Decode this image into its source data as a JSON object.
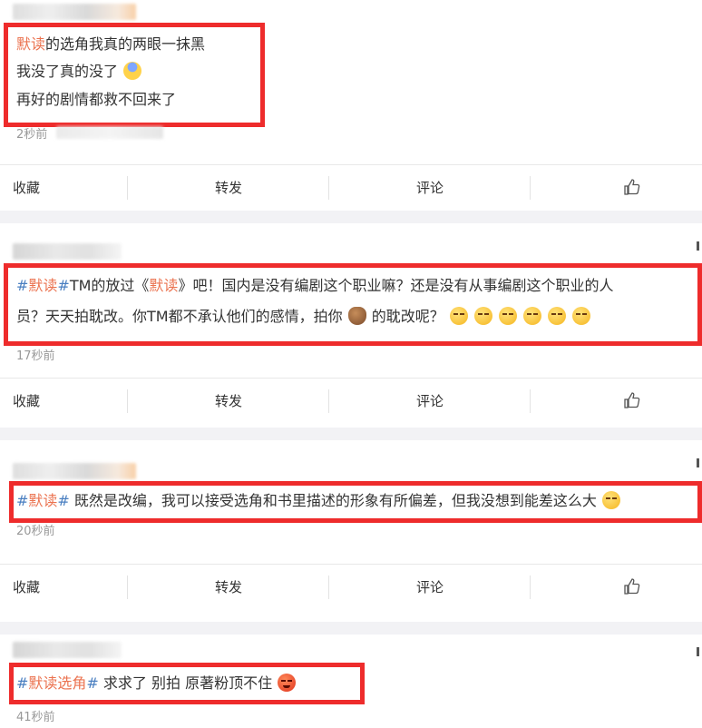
{
  "posts": [
    {
      "lines": [
        {
          "topic": "默读",
          "rest": "的选角我真的两眼一抹黑"
        },
        {
          "text": "我没了真的没了"
        },
        {
          "text": "再好的剧情都救不回来了"
        }
      ],
      "emoji": "scared-face-emoji",
      "time": "2秒前"
    },
    {
      "hash_open": "#",
      "topic": "默读",
      "hash_close": "#",
      "line1_a": "TM的放过《",
      "line1_topic": "默读",
      "line1_b": "》吧！国内是没有编剧这个职业嘛？还是没有从事编剧这个职业的人",
      "line2_a": "员？天天拍耽改。你TM都不承认他们的感情，拍你",
      "line2_b": "的耽改呢？",
      "time": "17秒前"
    },
    {
      "hash_open": "#",
      "topic": "默读",
      "hash_close": "#",
      "text": " 既然是改编，我可以接受选角和书里描述的形象有所偏差，但我没想到能差这么大",
      "time": "20秒前"
    },
    {
      "hash_open": "#",
      "topic": "默读选角",
      "hash_close": "#",
      "text": " 求求了 别拍 原著粉顶不住",
      "time": "41秒前"
    }
  ],
  "actions": {
    "collect": "收藏",
    "repost": "转发",
    "comment": "评论"
  },
  "colors": {
    "highlight_border": "#ee2c2c",
    "topic": "#eb7350",
    "hashtag": "#4a7fc1",
    "gap": "#f2f2f5"
  }
}
